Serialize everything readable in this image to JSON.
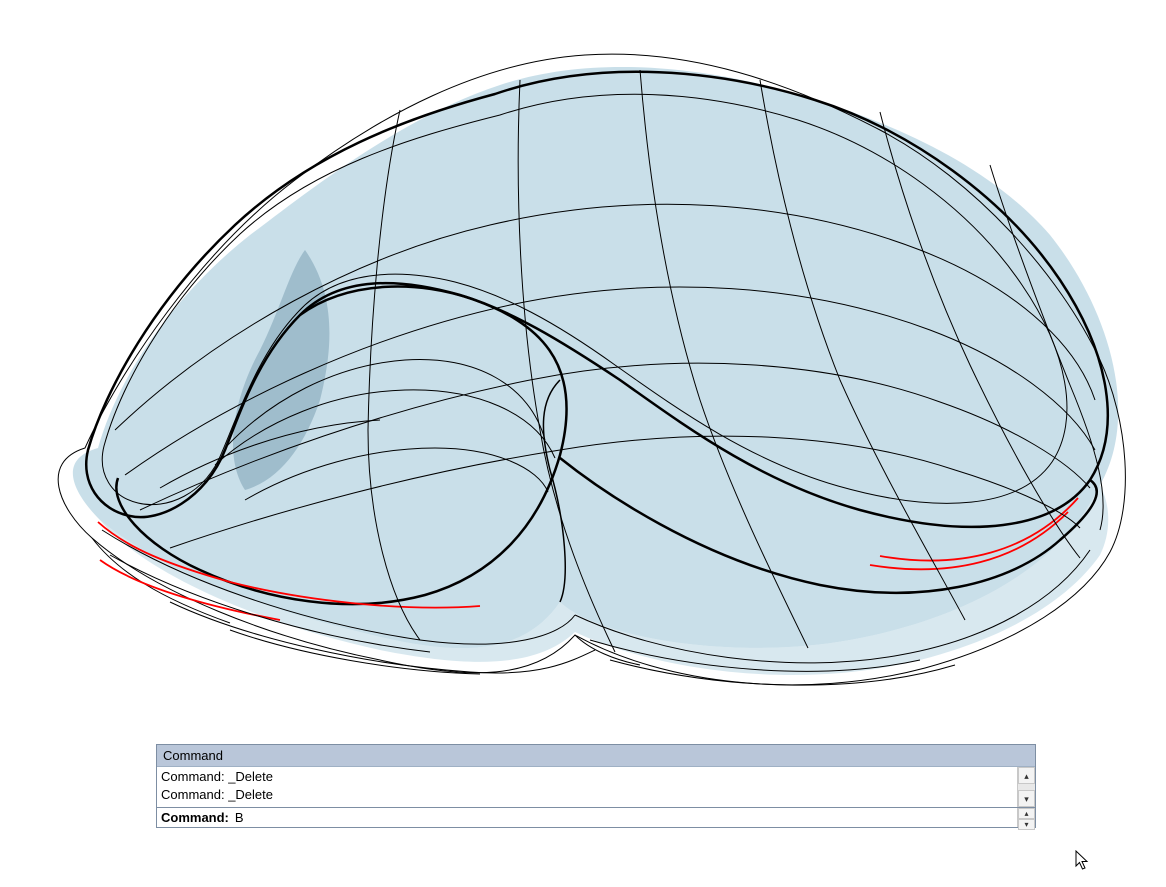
{
  "command_panel": {
    "header": "Command",
    "history": [
      "Command: _Delete",
      "Command: _Delete"
    ],
    "prompt": "Command:",
    "input_value": "B"
  },
  "colors": {
    "surface_fill": "#a8cbdc",
    "naked_edge": "#ff0000",
    "panel_header": "#b9c6d9",
    "panel_border": "#7d8ea3"
  }
}
